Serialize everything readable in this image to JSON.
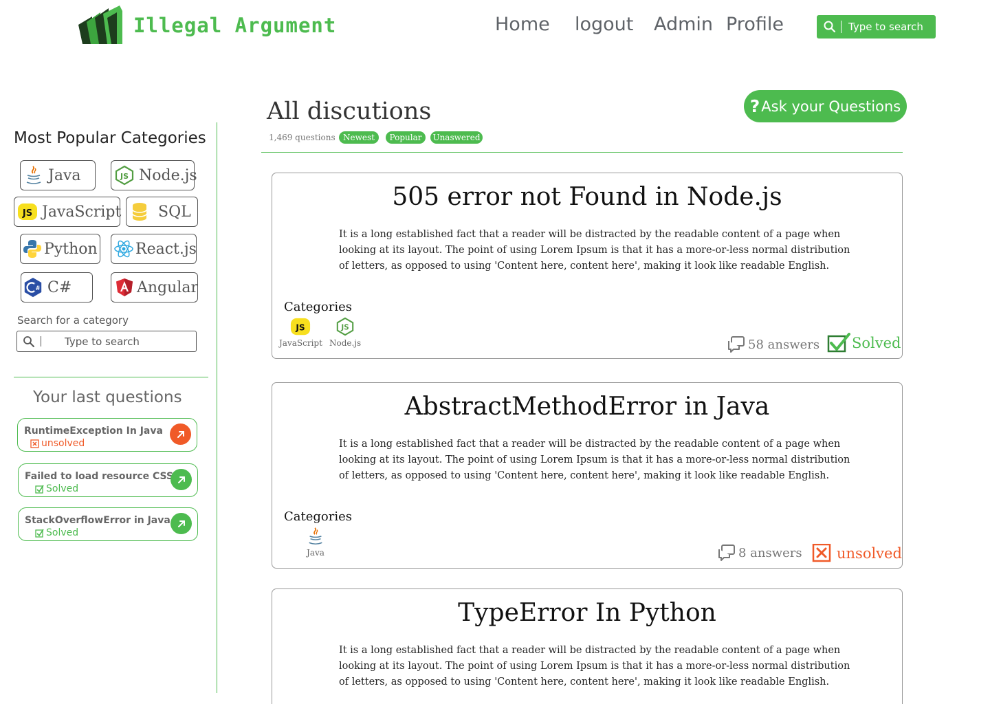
{
  "header": {
    "logo_text": "Illegal Argument",
    "nav": [
      {
        "label": "Home"
      },
      {
        "label": "logout"
      },
      {
        "label": "Admin"
      },
      {
        "label": "Profile"
      }
    ],
    "search_placeholder": "Type to search"
  },
  "sidebar": {
    "categories_heading": "Most Popular Categories",
    "categories": [
      {
        "label": "Java",
        "icon": "java-icon"
      },
      {
        "label": "Node.js",
        "icon": "nodejs-icon"
      },
      {
        "label": "JavaScript",
        "icon": "javascript-icon"
      },
      {
        "label": "SQL",
        "icon": "database-icon"
      },
      {
        "label": "Python",
        "icon": "python-icon"
      },
      {
        "label": "React.js",
        "icon": "react-icon"
      },
      {
        "label": "C#",
        "icon": "csharp-icon"
      },
      {
        "label": "Angular",
        "icon": "angular-icon"
      }
    ],
    "search_label": "Search for a category",
    "search_placeholder": "Type to search",
    "last_heading": "Your last questions",
    "last_questions": [
      {
        "title": "RuntimeException In Java",
        "status": "unsolved"
      },
      {
        "title": "Failed to load resource CSS",
        "status": "Solved"
      },
      {
        "title": "StackOverflowError in Java",
        "status": "Solved"
      }
    ]
  },
  "main": {
    "title": "All discutions",
    "count": "1,469 questions",
    "filters": [
      "Newest",
      "Popular",
      "Unaswered"
    ],
    "ask_label": "Ask your Questions",
    "ask_icon": "?",
    "categories_label": "Categories",
    "questions": [
      {
        "title": "505 error not Found in Node.js",
        "body": "It is a long established fact that a reader will be distracted by the readable content of a page when looking at its layout. The point of using Lorem Ipsum is that it has a more-or-less normal distribution of letters, as opposed to using 'Content here, content here', making it look like readable English.",
        "tags": [
          {
            "label": "JavaScript",
            "icon": "javascript-icon"
          },
          {
            "label": "Node.js",
            "icon": "nodejs-icon"
          }
        ],
        "answers": "58 answers",
        "status": "Solved"
      },
      {
        "title": "AbstractMethodError in Java",
        "body": "It is a long established fact that a reader will be distracted by the readable content of a page when looking at its layout. The point of using Lorem Ipsum is that it has a more-or-less normal distribution of letters, as opposed to using 'Content here, content here', making it look like readable English.",
        "tags": [
          {
            "label": "Java",
            "icon": "java-icon"
          }
        ],
        "answers": "8 answers",
        "status": "unsolved"
      },
      {
        "title": "TypeError In Python",
        "body": "It is a long established fact that a reader will be distracted by the readable content of a page when looking at its layout. The point of using Lorem Ipsum is that it has a more-or-less normal distribution of letters, as opposed to using 'Content here, content here', making it look like readable English."
      }
    ]
  },
  "colors": {
    "accent": "#4dbb4f",
    "unsolved": "#f05a28",
    "text_gray": "#5f6368"
  }
}
